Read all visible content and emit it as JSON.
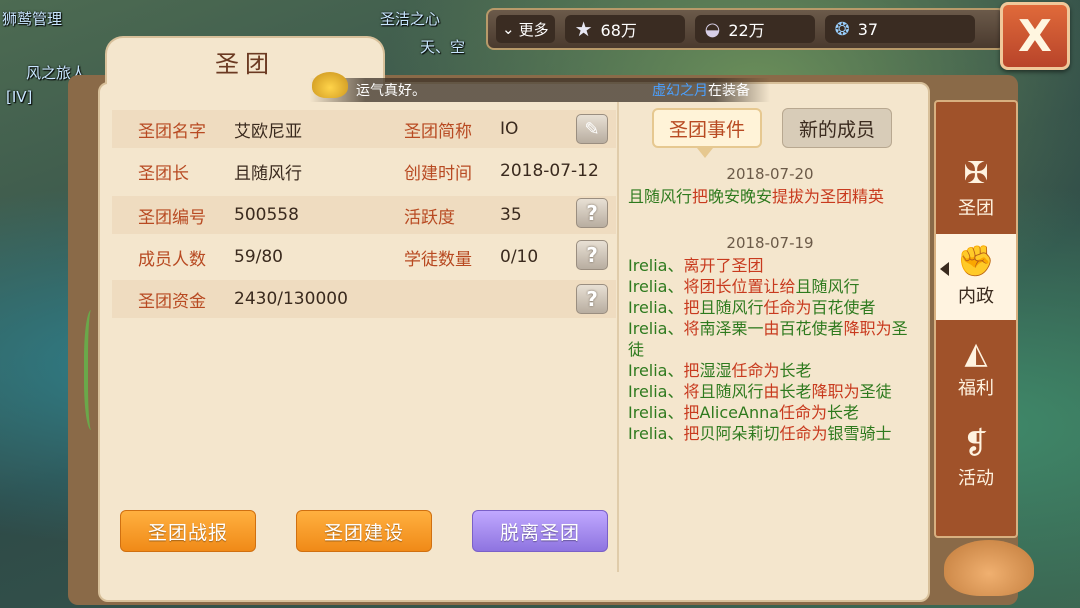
{
  "world": {
    "names": [
      {
        "text": "狮鹫管理",
        "cls": "n1"
      },
      {
        "text": "[IV]",
        "cls": "n2"
      },
      {
        "text": "风之旅人",
        "cls": "n3"
      },
      {
        "text": "圣洁之心",
        "cls": "n4"
      },
      {
        "text": "天、空",
        "cls": "n5"
      }
    ]
  },
  "topbar": {
    "more_label": "更多",
    "resources": [
      {
        "icon": "star-icon",
        "value": "68万"
      },
      {
        "icon": "shell-icon",
        "value": "22万"
      },
      {
        "icon": "crystal-icon",
        "value": "37"
      }
    ]
  },
  "close_label": "X",
  "title": "圣团",
  "lucky_text": "运气真好。",
  "strip_right": {
    "name": "虚幻之月",
    "text": "在装备"
  },
  "info": {
    "name_label": "圣团名字",
    "name": "艾欧尼亚",
    "abbr_label": "圣团简称",
    "abbr": "IO",
    "leader_label": "圣团长",
    "leader": "且随风行",
    "created_label": "创建时间",
    "created": "2018-07-12",
    "id_label": "圣团编号",
    "id": "500558",
    "activity_label": "活跃度",
    "activity": "35",
    "members_label": "成员人数",
    "members": "59/80",
    "apprentice_label": "学徒数量",
    "apprentice": "0/10",
    "funds_label": "圣团资金",
    "funds": "2430/130000"
  },
  "buttons": {
    "battle_report": "圣团战报",
    "construction": "圣团建设",
    "leave": "脱离圣团"
  },
  "tabs": {
    "events": "圣团事件",
    "new_members": "新的成员"
  },
  "events": {
    "date1": "2018-07-20",
    "date2": "2018-07-19"
  },
  "side_nav": [
    {
      "icon": "guild-emblem-icon",
      "label": "圣团"
    },
    {
      "icon": "fist-icon",
      "label": "内政"
    },
    {
      "icon": "cake-icon",
      "label": "福利"
    },
    {
      "icon": "scroll-icon",
      "label": "活动"
    }
  ],
  "colors": {
    "label_red": "#b84a22",
    "event_green": "#2e7a1e",
    "event_red": "#c83a1e",
    "orange_button": "#f08a18",
    "purple_button": "#8e74e0"
  }
}
